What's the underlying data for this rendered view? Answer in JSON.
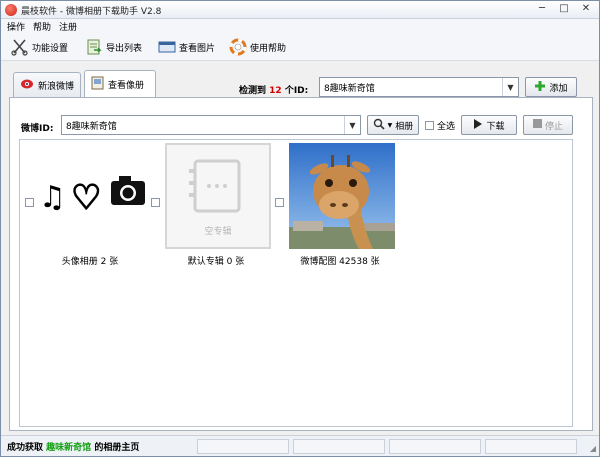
{
  "window": {
    "title": "晨枝软件 - 微博相册下载助手 V2.8",
    "controls": [
      "─",
      "□",
      "✕"
    ]
  },
  "menu": [
    "操作",
    "帮助",
    "注册"
  ],
  "toolbar": [
    {
      "label": "功能设置",
      "icon": "scissors-icon"
    },
    {
      "label": "导出列表",
      "icon": "export-icon"
    },
    {
      "label": "查看图片",
      "icon": "picture-icon"
    },
    {
      "label": "使用帮助",
      "icon": "lifebuoy-icon"
    }
  ],
  "tabs": [
    {
      "label": "新浪微博",
      "icon": "weibo-eye-icon",
      "active": false
    },
    {
      "label": "查看像册",
      "icon": "album-icon",
      "active": true
    }
  ],
  "detected": {
    "prefix": "检测到",
    "count": "12",
    "suffix": "个ID:"
  },
  "id_select": {
    "value": "8趣味新奇馆"
  },
  "add_button": "添加",
  "weibo_id": {
    "label": "微博ID:",
    "value": "8趣味新奇馆"
  },
  "album_button": "相册",
  "select_all": "全选",
  "download_button": "下载",
  "stop_button": "停止",
  "albums": [
    {
      "caption": "头像相册 2 张",
      "type": "avatar"
    },
    {
      "caption": "默认专辑 0 张",
      "type": "empty",
      "empty_label": "空专辑"
    },
    {
      "caption": "微博配图 42538 张",
      "type": "giraffe"
    }
  ],
  "status": {
    "prefix": "成功获取",
    "name": "趣味新奇馆",
    "suffix": "的相册主页"
  },
  "colors": {
    "count_red": "#d40000",
    "status_green": "#15a015"
  }
}
